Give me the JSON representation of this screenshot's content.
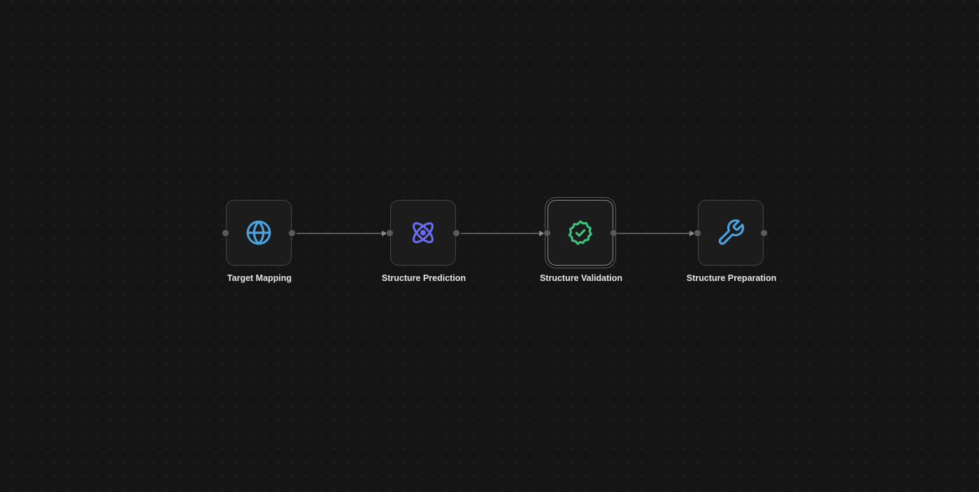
{
  "workflow": {
    "nodes": [
      {
        "id": "target-mapping",
        "label": "Target Mapping",
        "icon": "globe-icon",
        "color": "#4aa3df",
        "selected": false
      },
      {
        "id": "structure-prediction",
        "label": "Structure Prediction",
        "icon": "atom-icon",
        "color": "#6b6bf0",
        "selected": false
      },
      {
        "id": "structure-validation",
        "label": "Structure Validation",
        "icon": "badge-check-icon",
        "color": "#3ec47a",
        "selected": true
      },
      {
        "id": "structure-preparation",
        "label": "Structure Preparation",
        "icon": "wrench-icon",
        "color": "#4aa3df",
        "selected": false
      }
    ],
    "edge_color": "#6e6e6e"
  }
}
